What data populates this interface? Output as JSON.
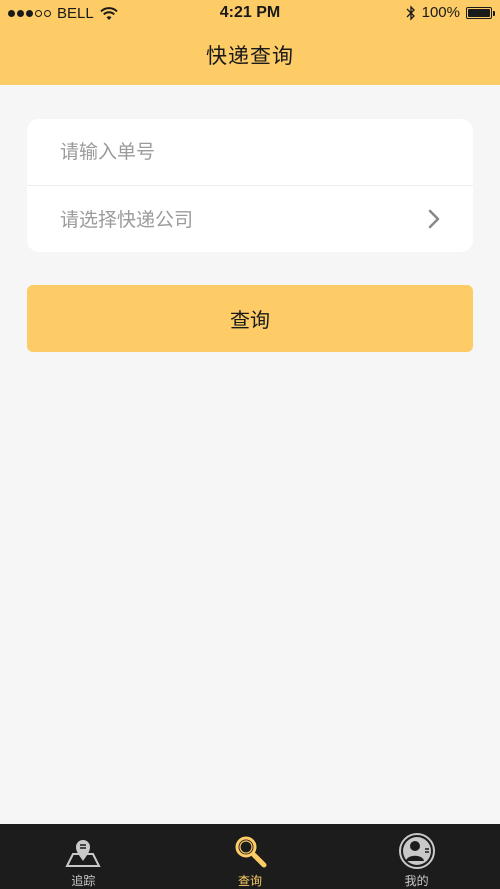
{
  "status_bar": {
    "carrier": "BELL",
    "time": "4:21 PM",
    "battery_percent": "100%",
    "signal_strength": 3,
    "signal_max": 5
  },
  "nav": {
    "title": "快递查询"
  },
  "form": {
    "tracking_number_placeholder": "请输入单号",
    "tracking_number_value": "",
    "courier_select_placeholder": "请选择快递公司"
  },
  "query_button": {
    "label": "查询"
  },
  "tabbar": {
    "tabs": [
      {
        "label": "追踪",
        "icon": "map-pin-icon",
        "active": false
      },
      {
        "label": "查询",
        "icon": "magnifier-icon",
        "active": true
      },
      {
        "label": "我的",
        "icon": "user-icon",
        "active": false
      }
    ]
  },
  "colors": {
    "accent": "#fdcc66",
    "background": "#f6f6f6",
    "tabbar": "#1c1c1c",
    "placeholder": "#9b9b9b"
  }
}
